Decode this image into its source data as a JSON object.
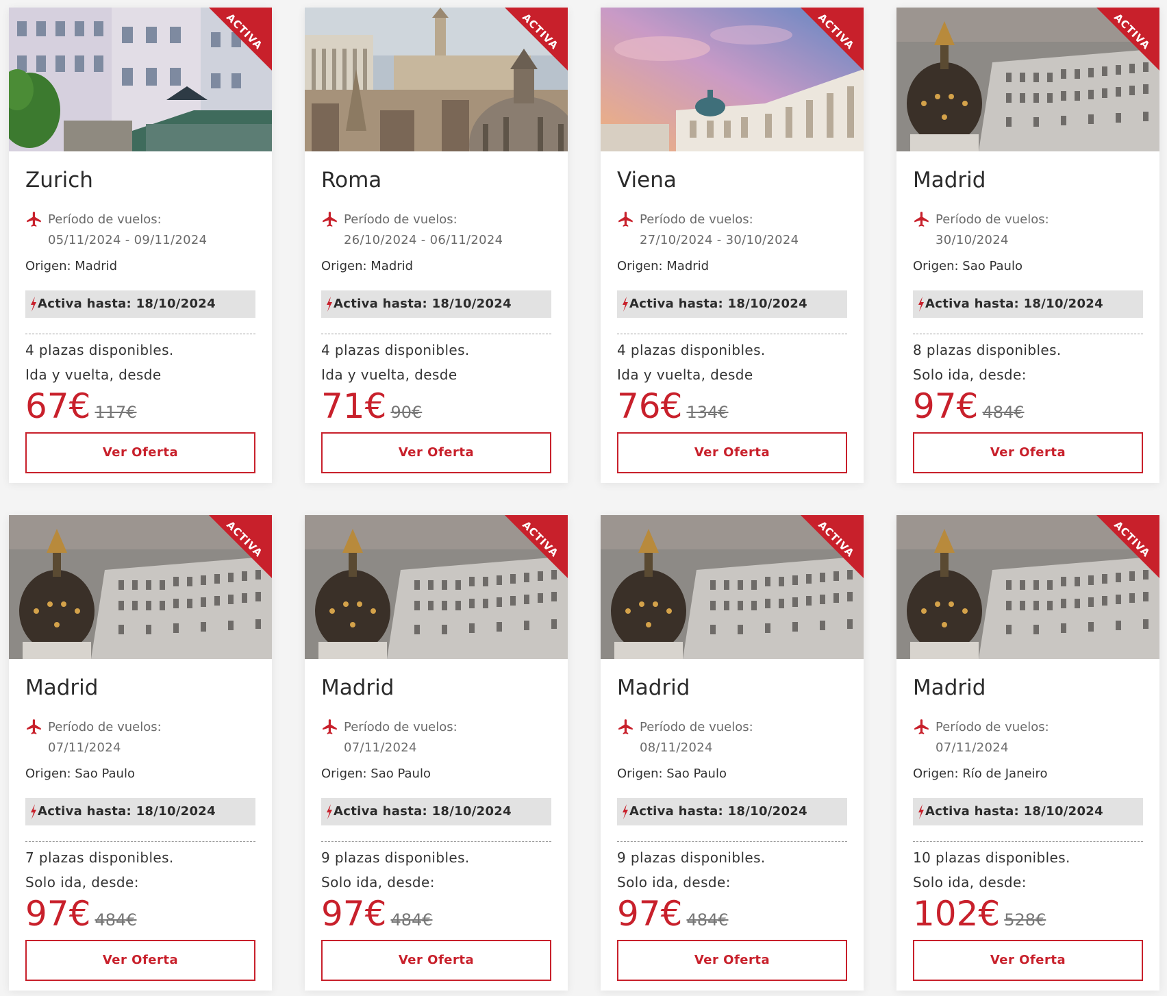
{
  "colors": {
    "accent": "#c8202b",
    "badge_bg": "#e2e2e2",
    "card_bg": "#ffffff",
    "page_bg": "#f4f4f4"
  },
  "icons": {
    "plane": "plane-icon",
    "bolt": "lightning-icon"
  },
  "cards": [
    {
      "ribbon": "ACTIVA",
      "image": "zurich-buildings-photo",
      "city": "Zurich",
      "period_label": "Período de vuelos:",
      "dates": "05/11/2024 - 09/11/2024",
      "origin": "Origen: Madrid",
      "active_until": "Activa hasta: 18/10/2024",
      "seats": "4 plazas disponibles.",
      "trip_type": "Ida y vuelta, desde",
      "price": "67€",
      "old_price": "117€",
      "button": "Ver Oferta"
    },
    {
      "ribbon": "ACTIVA",
      "image": "rome-skyline-photo",
      "city": "Roma",
      "period_label": "Período de vuelos:",
      "dates": "26/10/2024 - 06/11/2024",
      "origin": "Origen: Madrid",
      "active_until": "Activa hasta: 18/10/2024",
      "seats": "4 plazas disponibles.",
      "trip_type": "Ida y vuelta, desde",
      "price": "71€",
      "old_price": "90€",
      "button": "Ver Oferta"
    },
    {
      "ribbon": "ACTIVA",
      "image": "vienna-palace-sunset-photo",
      "city": "Viena",
      "period_label": "Período de vuelos:",
      "dates": "27/10/2024 - 30/10/2024",
      "origin": "Origen: Madrid",
      "active_until": "Activa hasta: 18/10/2024",
      "seats": "4 plazas disponibles.",
      "trip_type": "Ida y vuelta, desde",
      "price": "76€",
      "old_price": "134€",
      "button": "Ver Oferta"
    },
    {
      "ribbon": "ACTIVA",
      "image": "madrid-metropolis-photo",
      "city": "Madrid",
      "period_label": "Período de vuelos:",
      "dates": "30/10/2024",
      "origin": "Origen: Sao Paulo",
      "active_until": "Activa hasta: 18/10/2024",
      "seats": "8 plazas disponibles.",
      "trip_type": "Solo ida, desde:",
      "price": "97€",
      "old_price": "484€",
      "button": "Ver Oferta"
    },
    {
      "ribbon": "ACTIVA",
      "image": "madrid-metropolis-photo",
      "city": "Madrid",
      "period_label": "Período de vuelos:",
      "dates": "07/11/2024",
      "origin": "Origen: Sao Paulo",
      "active_until": "Activa hasta: 18/10/2024",
      "seats": "7 plazas disponibles.",
      "trip_type": "Solo ida, desde:",
      "price": "97€",
      "old_price": "484€",
      "button": "Ver Oferta"
    },
    {
      "ribbon": "ACTIVA",
      "image": "madrid-metropolis-photo",
      "city": "Madrid",
      "period_label": "Período de vuelos:",
      "dates": "07/11/2024",
      "origin": "Origen: Sao Paulo",
      "active_until": "Activa hasta: 18/10/2024",
      "seats": "9 plazas disponibles.",
      "trip_type": "Solo ida, desde:",
      "price": "97€",
      "old_price": "484€",
      "button": "Ver Oferta"
    },
    {
      "ribbon": "ACTIVA",
      "image": "madrid-metropolis-photo",
      "city": "Madrid",
      "period_label": "Período de vuelos:",
      "dates": "08/11/2024",
      "origin": "Origen: Sao Paulo",
      "active_until": "Activa hasta: 18/10/2024",
      "seats": "9 plazas disponibles.",
      "trip_type": "Solo ida, desde:",
      "price": "97€",
      "old_price": "484€",
      "button": "Ver Oferta"
    },
    {
      "ribbon": "ACTIVA",
      "image": "madrid-metropolis-photo",
      "city": "Madrid",
      "period_label": "Período de vuelos:",
      "dates": "07/11/2024",
      "origin": "Origen: Río de Janeiro",
      "active_until": "Activa hasta: 18/10/2024",
      "seats": "10 plazas disponibles.",
      "trip_type": "Solo ida, desde:",
      "price": "102€",
      "old_price": "528€",
      "button": "Ver Oferta"
    }
  ]
}
